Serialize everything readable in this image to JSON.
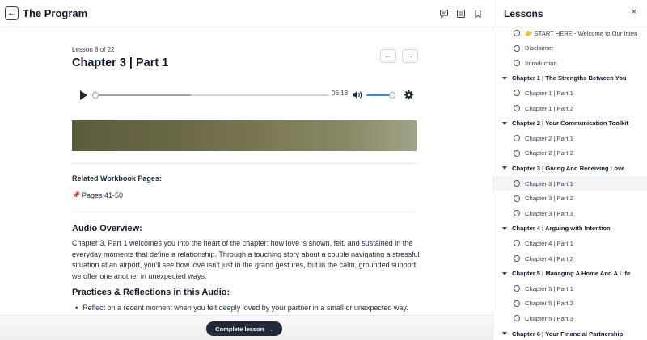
{
  "header": {
    "title": "The Program",
    "icons": [
      "comment-icon",
      "notes-icon",
      "bookmark-icon"
    ]
  },
  "lesson": {
    "counter": "Lesson 8 of 22",
    "title": "Chapter 3 | Part 1"
  },
  "player": {
    "time": "06:13",
    "progress": 0,
    "buffered": 0.41,
    "volume": 0.9
  },
  "workbook": {
    "label": "Related Workbook Pages:",
    "pages_icon": "📌",
    "pages": "Pages 41-50"
  },
  "overview": {
    "title": "Audio Overview:",
    "body": "Chapter 3, Part 1 welcomes you into the heart of the chapter: how love is shown, felt, and sustained in the everyday moments that define a relationship. Through a touching story about a couple navigating a stressful situation at an airport, you'll see how love isn't just in the grand gestures, but in the calm, grounded support we offer one another in unexpected ways."
  },
  "practices": {
    "title": "Practices & Reflections in this Audio:",
    "bullets": [
      "Reflect on a recent moment when you felt deeply loved by your partner in a small or unexpected way."
    ]
  },
  "footer": {
    "complete_label": "Complete lesson",
    "complete_arrow": "→"
  },
  "sidebar": {
    "title": "Lessons",
    "close": "×",
    "items": [
      {
        "type": "lesson",
        "label": "👉 START HERE - Welcome to Our Inten"
      },
      {
        "type": "lesson",
        "label": "Disclaimer"
      },
      {
        "type": "lesson",
        "label": "Introduction"
      },
      {
        "type": "chapter",
        "label": "Chapter 1 | The Strengths Between You"
      },
      {
        "type": "lesson",
        "label": "Chapter 1 | Part 1"
      },
      {
        "type": "lesson",
        "label": "Chapter 1 | Part 2"
      },
      {
        "type": "chapter",
        "label": "Chapter 2 | Your Communication Toolkit"
      },
      {
        "type": "lesson",
        "label": "Chapter 2 | Part 1"
      },
      {
        "type": "lesson",
        "label": "Chapter 2 | Part 2"
      },
      {
        "type": "chapter",
        "label": "Chapter 3 | Giving And Receiving Love"
      },
      {
        "type": "lesson",
        "label": "Chapter 3 | Part 1",
        "active": true
      },
      {
        "type": "lesson",
        "label": "Chapter 3 | Part 2"
      },
      {
        "type": "lesson",
        "label": "Chapter 3 | Part 3"
      },
      {
        "type": "chapter",
        "label": "Chapter 4 | Arguing with Intention"
      },
      {
        "type": "lesson",
        "label": "Chapter 4 | Part 1"
      },
      {
        "type": "lesson",
        "label": "Chapter 4 | Part 2"
      },
      {
        "type": "chapter",
        "label": "Chapter 5 | Managing A Home And A Life"
      },
      {
        "type": "lesson",
        "label": "Chapter 5 | Part 1"
      },
      {
        "type": "lesson",
        "label": "Chapter 5 | Part 2"
      },
      {
        "type": "lesson",
        "label": "Chapter 5 | Part 3"
      },
      {
        "type": "chapter",
        "label": "Chapter 6 | Your Financial Partnership"
      }
    ]
  }
}
